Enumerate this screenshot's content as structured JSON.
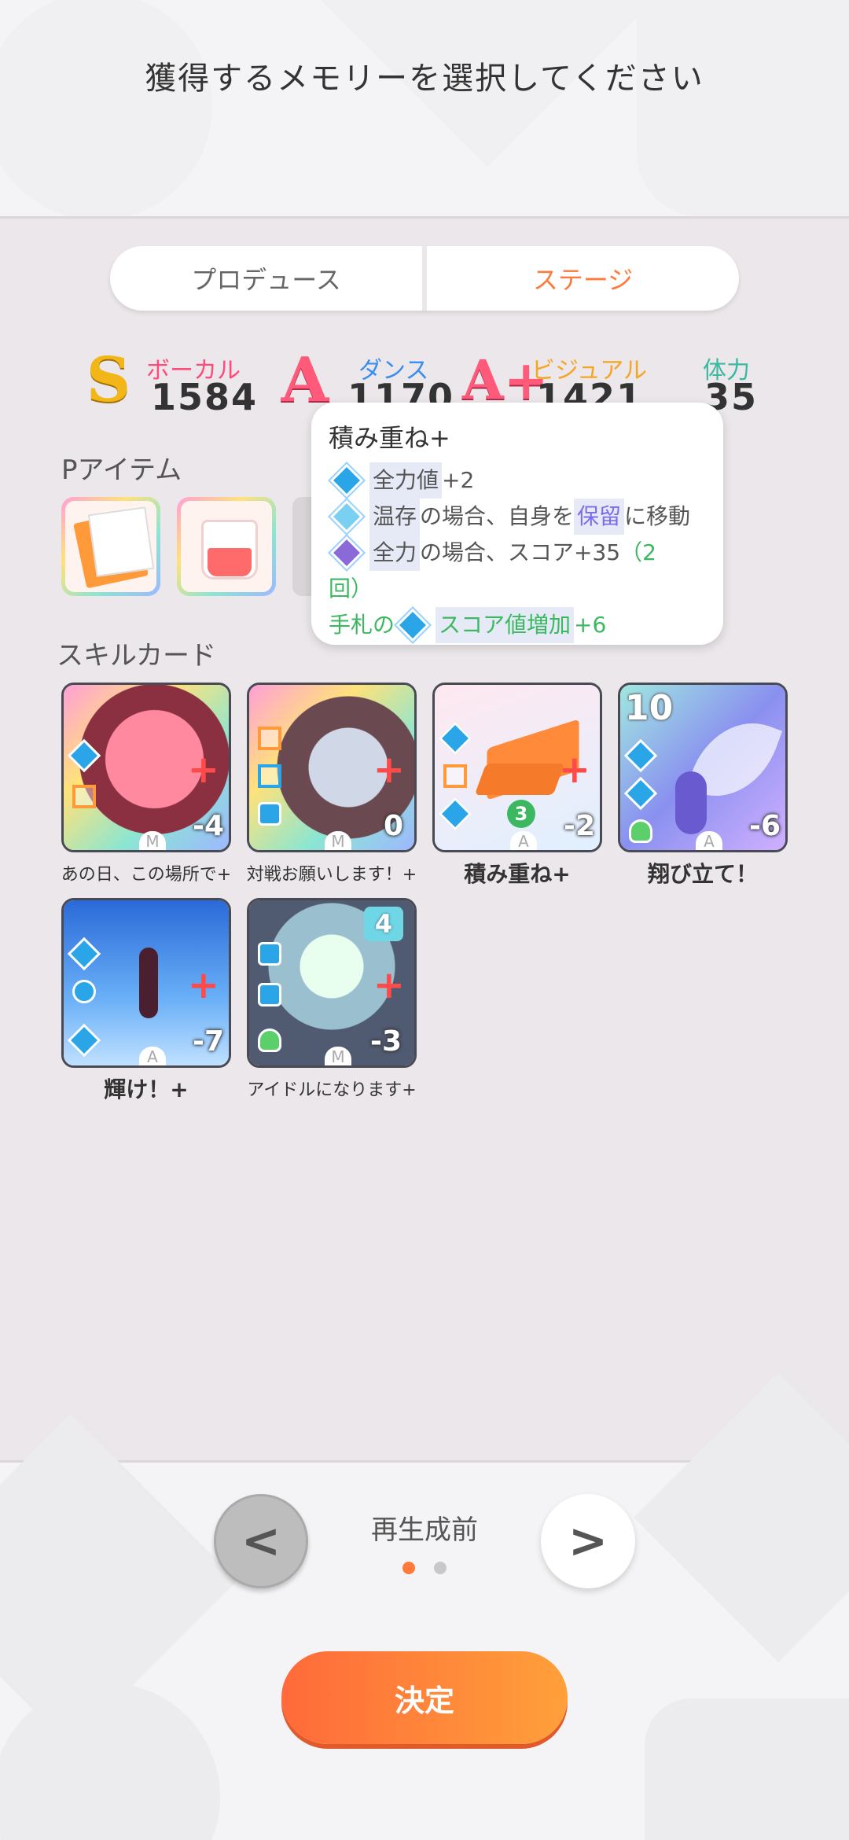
{
  "header": {
    "title": "獲得するメモリーを選択してください"
  },
  "tabs": [
    {
      "label": "プロデュース",
      "active": false
    },
    {
      "label": "ステージ",
      "active": true
    }
  ],
  "stats": [
    {
      "grade": "S",
      "label": "ボーカル",
      "value": "1584",
      "color": "#ff4a7a"
    },
    {
      "grade": "A",
      "label": "ダンス",
      "value": "1170",
      "color": "#3a8ef0"
    },
    {
      "grade": "A+",
      "label": "ビジュアル",
      "value": "1421",
      "color": "#f5a623"
    },
    {
      "grade": "",
      "label": "体力",
      "value": "35",
      "color": "#3bb8a0"
    }
  ],
  "sections": {
    "p_items": "Pアイテム",
    "skill_cards": "スキルカード"
  },
  "tooltip": {
    "title": "積み重ね+",
    "line1_key": "全力値",
    "line1_rest": "+2",
    "line2_key": "温存",
    "line2_mid": "の場合、自身を",
    "line2_hl": "保留",
    "line2_rest": "に移動",
    "line3_key": "全力",
    "line3_mid": "の場合、スコア+35",
    "line3_green": "（2",
    "line3_cont": "回）",
    "line4_pre": "手札の",
    "line4_key": "スコア値増加",
    "line4_rest": "+6"
  },
  "cards": [
    {
      "name": "あの日、この場所で+",
      "cost": "-4",
      "letter": "M",
      "big": false
    },
    {
      "name": "対戦お願いします！+",
      "cost": "0",
      "letter": "M",
      "big": false
    },
    {
      "name": "積み重ね+",
      "cost": "-2",
      "letter": "A",
      "big": true,
      "count": "3"
    },
    {
      "name": "翔び立て！",
      "cost": "-6",
      "letter": "A",
      "big": true,
      "level": "10"
    },
    {
      "name": "輝け！+",
      "cost": "-7",
      "letter": "A",
      "big": true
    },
    {
      "name": "アイドルになります+",
      "cost": "-3",
      "letter": "M",
      "big": false,
      "badge": "4"
    }
  ],
  "footer": {
    "page_label": "再生成前",
    "prev_icon": "chevron-left-icon",
    "next_icon": "chevron-right-icon",
    "prev_glyph": "<",
    "next_glyph": ">",
    "confirm_label": "決定",
    "accent": "#ff7a3a"
  }
}
